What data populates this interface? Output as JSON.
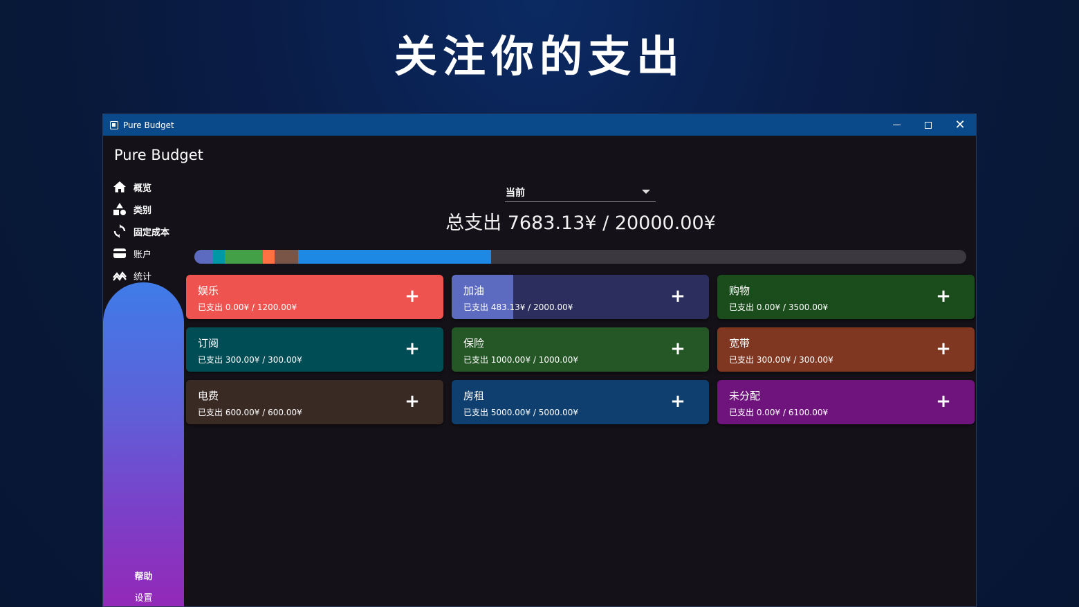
{
  "hero_title": "关注你的支出",
  "window": {
    "title": "Pure Budget"
  },
  "sidebar": {
    "app_name": "Pure Budget",
    "items": [
      {
        "label": "概览",
        "icon": "home-icon"
      },
      {
        "label": "类别",
        "icon": "shapes-icon"
      },
      {
        "label": "固定成本",
        "icon": "refresh-icon"
      },
      {
        "label": "账户",
        "icon": "wallet-icon"
      },
      {
        "label": "统计",
        "icon": "chart-icon"
      }
    ],
    "help": "帮助",
    "settings": "设置"
  },
  "main": {
    "period": "当前",
    "total": "总支出 7683.13¥ / 20000.00¥",
    "progress_segments": [
      {
        "color": "#5c6bc0",
        "percent": 2.4
      },
      {
        "color": "#0097a7",
        "percent": 1.5
      },
      {
        "color": "#43a047",
        "percent": 5.0
      },
      {
        "color": "#ff7043",
        "percent": 1.5
      },
      {
        "color": "#795548",
        "percent": 3.0
      },
      {
        "color": "#1e88e5",
        "percent": 25.0
      }
    ],
    "categories": [
      {
        "name": "娱乐",
        "spent": "已支出 0.00¥ / 1200.00¥",
        "color": "#ef5350",
        "fill_color": "#ef5350",
        "progress": 0
      },
      {
        "name": "加油",
        "spent": "已支出 483.13¥ / 2000.00¥",
        "color": "#2c2f5e",
        "fill_color": "#5c6bc0",
        "progress": 0.24
      },
      {
        "name": "购物",
        "spent": "已支出 0.00¥ / 3500.00¥",
        "color": "#1b4d1c",
        "fill_color": "#1b4d1c",
        "progress": 0
      },
      {
        "name": "订阅",
        "spent": "已支出 300.00¥ / 300.00¥",
        "color": "#004d55",
        "fill_color": "#004d55",
        "progress": 1
      },
      {
        "name": "保险",
        "spent": "已支出 1000.00¥ / 1000.00¥",
        "color": "#255625",
        "fill_color": "#255625",
        "progress": 1
      },
      {
        "name": "宽带",
        "spent": "已支出 300.00¥ / 300.00¥",
        "color": "#7f3722",
        "fill_color": "#7f3722",
        "progress": 1
      },
      {
        "name": "电费",
        "spent": "已支出 600.00¥ / 600.00¥",
        "color": "#3a2a24",
        "fill_color": "#3a2a24",
        "progress": 1
      },
      {
        "name": "房租",
        "spent": "已支出 5000.00¥ / 5000.00¥",
        "color": "#0f3f6e",
        "fill_color": "#0f3f6e",
        "progress": 1
      },
      {
        "name": "未分配",
        "spent": "已支出 0.00¥ / 6100.00¥",
        "color": "#6e147c",
        "fill_color": "#6e147c",
        "progress": 0
      }
    ],
    "add_label": "+"
  }
}
